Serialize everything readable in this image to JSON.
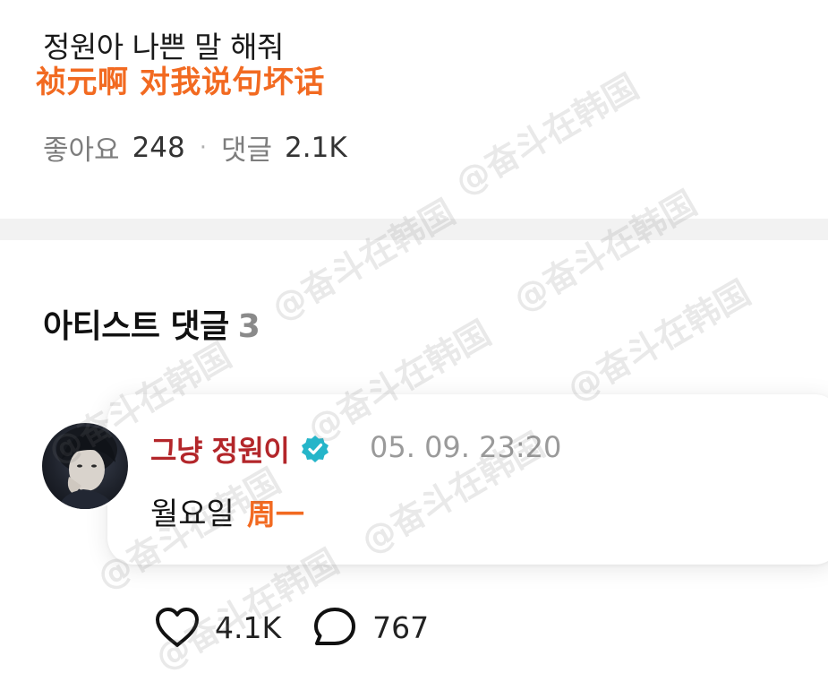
{
  "post": {
    "title": "정원아 나쁜 말 해줘",
    "translation": "祯元啊 对我说句坏话"
  },
  "stats": {
    "likes_label": "좋아요",
    "likes_count": "248",
    "separator": "·",
    "comments_label": "댓글",
    "comments_count": "2.1K"
  },
  "section": {
    "title": "아티스트 댓글",
    "count": "3"
  },
  "comment": {
    "author": "그냥 정원이",
    "timestamp": "05. 09. 23:20",
    "text": "월요일",
    "translation": "周一",
    "verified_badge_icon": "verified-check-icon",
    "avatar_icon": "artist-avatar"
  },
  "actions": {
    "like_icon": "heart-icon",
    "like_count": "4.1K",
    "reply_icon": "speech-bubble-icon",
    "reply_count": "767"
  },
  "watermark": {
    "text": "@奋斗在韩国"
  },
  "colors": {
    "translation_orange": "#f26a21",
    "author_red": "#b3262a",
    "verified_teal": "#25b5c9",
    "divider_gray": "#f2f2f2"
  }
}
